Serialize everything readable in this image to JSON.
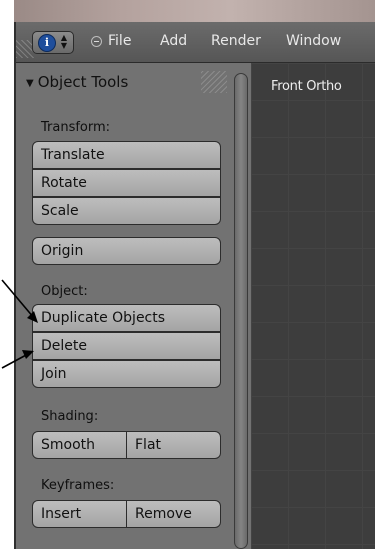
{
  "header": {
    "editor_type_icon": "info-icon",
    "editor_switch_icon": "up-down-arrows-icon",
    "collapse_icon": "minus-circle-icon",
    "menu": [
      "File",
      "Add",
      "Render",
      "Window"
    ]
  },
  "toolshelf": {
    "panel_title": "Object Tools",
    "panel_expand_icon": "triangle-down-icon",
    "sections": {
      "transform": {
        "label": "Transform:",
        "buttons": [
          "Translate",
          "Rotate",
          "Scale"
        ]
      },
      "origin": {
        "button": "Origin"
      },
      "object": {
        "label": "Object:",
        "buttons": [
          "Duplicate Objects",
          "Delete",
          "Join"
        ]
      },
      "shading": {
        "label": "Shading:",
        "buttons": [
          "Smooth",
          "Flat"
        ]
      },
      "keyframes": {
        "label": "Keyframes:",
        "buttons": [
          "Insert",
          "Remove"
        ]
      }
    }
  },
  "viewport": {
    "label": "Front Ortho"
  },
  "annotations": {
    "arrow_icons": [
      "arrow-to-duplicate-icon",
      "arrow-to-delete-icon"
    ]
  },
  "colors": {
    "header_bg": "#5e5e5e",
    "toolshelf_bg": "#727272",
    "button_bg": "#b3b3b3",
    "viewport_bg": "#3d3d3d",
    "info_icon_blue": "#1f4e9c"
  }
}
